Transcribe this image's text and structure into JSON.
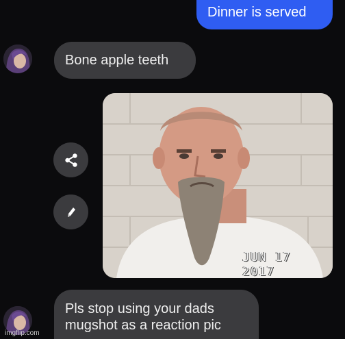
{
  "messages": {
    "sent_1": "Dinner is served",
    "received_1": "Bone apple teeth",
    "received_2_line1": "Pls stop using your dads",
    "received_2_line2": "mugshot as a reaction pic"
  },
  "photo": {
    "date_stamp": "JUN 17 2017"
  },
  "actions": {
    "share_icon": "share-icon",
    "edit_icon": "pencil-icon"
  },
  "watermark": "imgflip.com",
  "colors": {
    "background": "#0b0b0d",
    "sent_bubble": "#2f5df2",
    "received_bubble": "#3b3b3e"
  }
}
